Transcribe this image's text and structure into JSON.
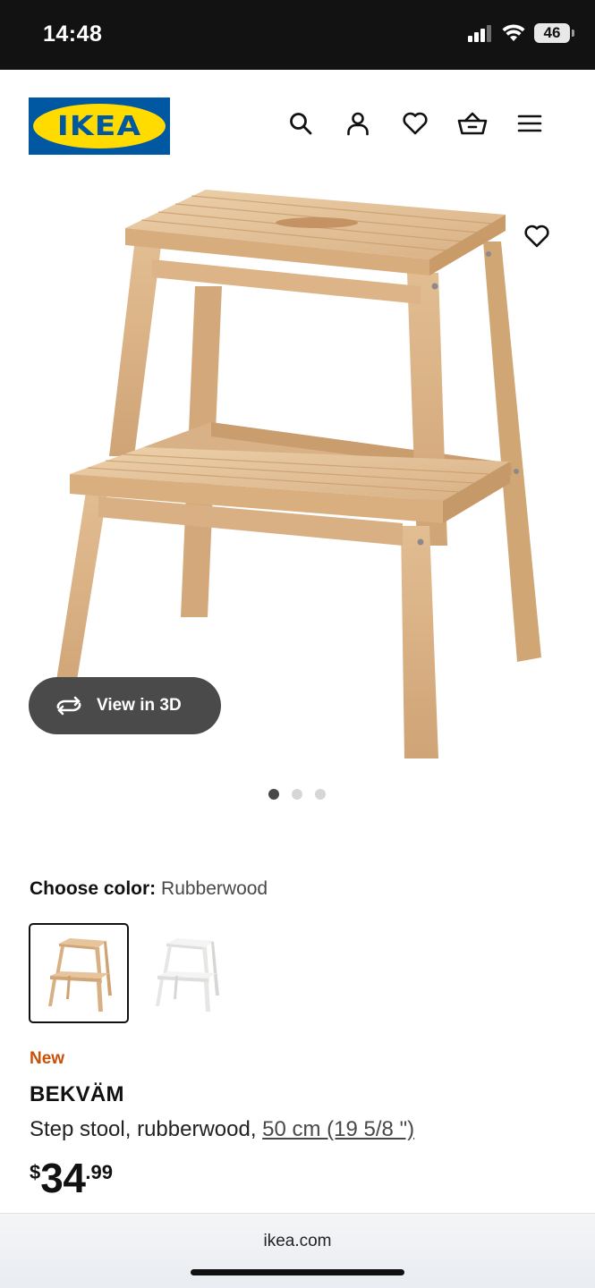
{
  "status_bar": {
    "time": "14:48",
    "battery": "46",
    "icons": [
      "cellular-icon",
      "wifi-icon",
      "battery-icon"
    ]
  },
  "header": {
    "logo_text": "IKEA",
    "icons": [
      "search-icon",
      "account-icon",
      "favorites-icon",
      "cart-icon",
      "menu-icon"
    ]
  },
  "gallery": {
    "view_3d_label": "View in 3D",
    "image_count": 3,
    "active_index": 0
  },
  "color_chooser": {
    "label": "Choose color:",
    "selected_value": "Rubberwood",
    "options": [
      "Rubberwood",
      "White"
    ]
  },
  "product": {
    "badge": "New",
    "name": "BEKVÄM",
    "description": "Step stool, rubberwood, ",
    "size_link": "50 cm (19 5/8 \")",
    "price_currency": "$",
    "price_int": "34",
    "price_dec": ".99"
  },
  "browser": {
    "url": "ikea.com"
  },
  "colors": {
    "brand_blue": "#0058a3",
    "brand_yellow": "#ffdb00",
    "new_badge": "#ca5008",
    "wood": "#e6c49c"
  }
}
